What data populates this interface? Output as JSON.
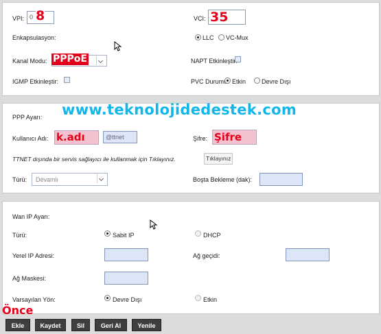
{
  "atm": {
    "vpi_label": "VPI:",
    "vpi_prefix": "0",
    "vpi_value": "8",
    "vci_label": "VCI:",
    "vci_value": "35",
    "encap_label": "Enkapsulasyon:",
    "encap_options": [
      "LLC",
      "VC-Mux"
    ],
    "encap_selected": "LLC",
    "channel_mode_label": "Kanal Modu:",
    "channel_mode_value": "PPPoE",
    "napt_label": "NAPT Etkinleştir:",
    "igmp_label": "IGMP Etkinleştir:",
    "pvc_label": "PVC Durumu:",
    "pvc_options": [
      "Etkin",
      "Devre Dışı"
    ],
    "pvc_selected": "Etkin"
  },
  "watermark": "www.teknolojidedestek.com",
  "ppp": {
    "section_label": "PPP Ayarı:",
    "username_label": "Kullanıcı Adı:",
    "username_value": "k.adı",
    "username_suffix": "@ttnet",
    "password_label": "Şifre:",
    "password_value": "Şifre",
    "ttnet_note": "TTNET dışında bir servis sağlayıcı ile kullanmak için Tıklayınız.",
    "ttnet_button": "Tıklayınız",
    "type_label": "Türü:",
    "type_value": "Devamlı",
    "idle_label": "Boşta Bekleme (dak):",
    "idle_value": ""
  },
  "wan": {
    "section_label": "Wan IP Ayarı:",
    "type_label": "Türü:",
    "type_options": [
      "Sabit IP",
      "DHCP"
    ],
    "type_selected": "Sabit IP",
    "local_ip_label": "Yerel IP Adresi:",
    "gateway_label": "Ağ geçidi:",
    "netmask_label": "Ağ Maskesi:",
    "default_route_label": "Varsayılan Yön:",
    "default_route_options": [
      "Devre Dışı",
      "Etkin"
    ],
    "default_route_selected": "Devre Dışı"
  },
  "caption": "Önce",
  "toolbar": {
    "add": "Ekle",
    "save": "Kaydet",
    "delete": "Sil",
    "back": "Geri Al",
    "refresh": "Yenile"
  },
  "colors": {
    "annotation_red": "#e3001b",
    "watermark_blue": "#12b6e8",
    "button_dark": "#3f3f3f"
  }
}
